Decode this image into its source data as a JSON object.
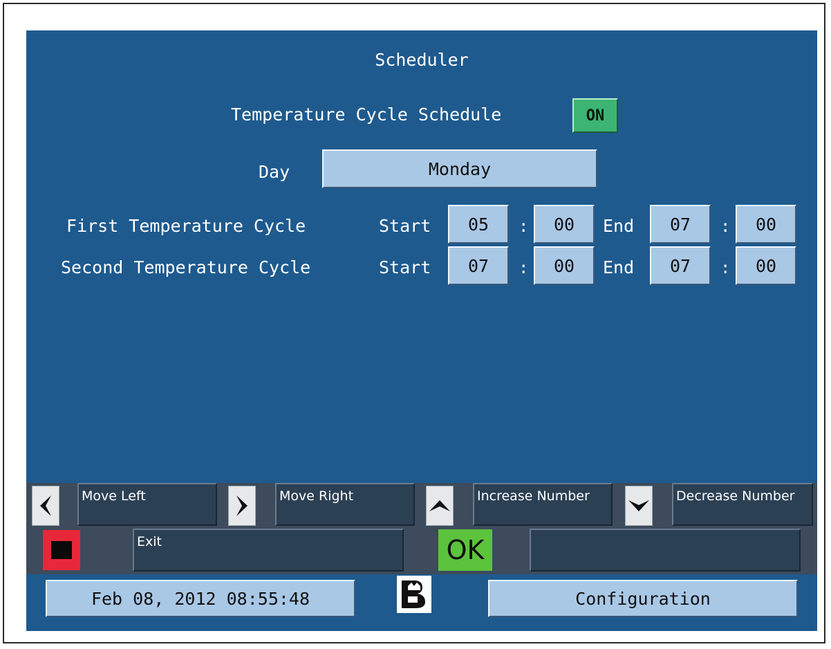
{
  "header": {
    "title": "Scheduler"
  },
  "schedule": {
    "label": "Temperature Cycle Schedule",
    "state": "ON",
    "day_label": "Day",
    "day_value": "Monday"
  },
  "cycles": [
    {
      "label": "First Temperature Cycle",
      "start_label": "Start",
      "start_h": "05",
      "start_m": "00",
      "end_label": "End",
      "end_h": "07",
      "end_m": "00"
    },
    {
      "label": "Second Temperature Cycle",
      "start_label": "Start",
      "start_h": "07",
      "start_m": "00",
      "end_label": "End",
      "end_h": "07",
      "end_m": "00"
    }
  ],
  "separator": ":",
  "keys": {
    "move_left": "Move Left",
    "move_right": "Move Right",
    "increase": "Increase Number",
    "decrease": "Decrease Number",
    "exit": "Exit",
    "ok": "OK",
    "ok_desc": ""
  },
  "footer": {
    "datetime": "Feb 08, 2012 08:55:48",
    "configuration": "Configuration"
  },
  "colors": {
    "background": "#1e5a8e",
    "button": "#a9c8e6",
    "on": "#3cb574",
    "stop": "#e8283a",
    "ok": "#5cc33c"
  },
  "icons": [
    "left-arrow-icon",
    "right-arrow-icon",
    "up-arrow-icon",
    "down-arrow-icon",
    "stop-icon",
    "logo-icon"
  ]
}
